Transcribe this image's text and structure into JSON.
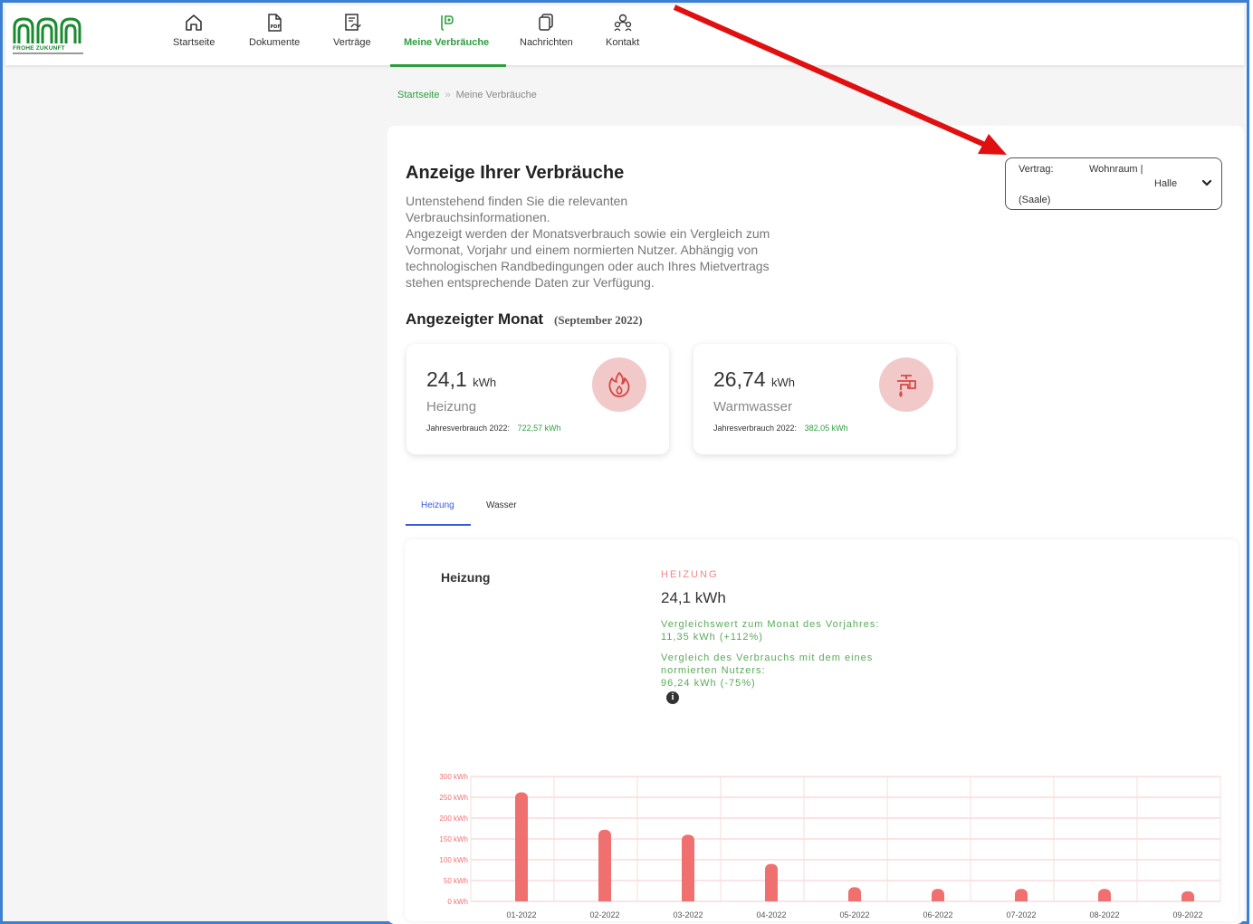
{
  "nav": {
    "logo_text": "FROHE ZUKUNFT",
    "items": [
      {
        "label": "Startseite",
        "icon": "home-icon"
      },
      {
        "label": "Dokumente",
        "icon": "pdf-document-icon"
      },
      {
        "label": "Verträge",
        "icon": "contract-icon"
      },
      {
        "label": "Meine Verbräuche",
        "icon": "consumption-icon",
        "active": true
      },
      {
        "label": "Nachrichten",
        "icon": "messages-icon"
      },
      {
        "label": "Kontakt",
        "icon": "contact-icon"
      }
    ]
  },
  "breadcrumb": {
    "home": "Startseite",
    "separator": "»",
    "current": "Meine Verbräuche"
  },
  "page": {
    "title": "Anzeige Ihrer Verbräuche",
    "description_1": "Untenstehend finden Sie die relevanten Verbrauchsinformationen.",
    "description_2": "Angezeigt werden der Monatsverbrauch sowie ein Vergleich zum Vormonat, Vorjahr und einem normierten Nutzer. Abhängig von technologischen Randbedingungen oder auch Ihres Mietvertrags stehen entsprechende Daten zur Verfügung."
  },
  "contract": {
    "label": "Vertrag:",
    "value_1": "Wohnraum |",
    "value_2": "Halle",
    "value_3": "(Saale)"
  },
  "month": {
    "title": "Angezeigter Monat",
    "value": "(September 2022)"
  },
  "cards": [
    {
      "value": "24,1",
      "unit": "kWh",
      "name": "Heizung",
      "yearly_label": "Jahresverbrauch 2022:",
      "yearly_value": "722,57 kWh",
      "icon": "flame-icon"
    },
    {
      "value": "26,74",
      "unit": "kWh",
      "name": "Warmwasser",
      "yearly_label": "Jahresverbrauch 2022:",
      "yearly_value": "382,05 kWh",
      "icon": "faucet-icon"
    }
  ],
  "tabs": [
    {
      "label": "Heizung",
      "active": true
    },
    {
      "label": "Wasser",
      "active": false
    }
  ],
  "section": {
    "title": "Heizung",
    "category": "HEIZUNG",
    "value": "24,1 kWh",
    "cmp1_label": "Vergleichswert zum Monat des Vorjahres:",
    "cmp1_value": "11,35 kWh (+112%)",
    "cmp2_label": "Vergleich des Verbrauchs mit dem eines normierten Nutzers:",
    "cmp2_value": "96,24 kWh (-75%)"
  },
  "colors": {
    "accent": "#2f9e3f",
    "bar": "#f07070",
    "tab_active": "#3a5bd9",
    "frame": "#3d7fd1",
    "arrow": "#e01010"
  },
  "chart_data": {
    "type": "bar",
    "categories": [
      "01-2022",
      "02-2022",
      "03-2022",
      "04-2022",
      "05-2022",
      "06-2022",
      "07-2022",
      "08-2022",
      "09-2022"
    ],
    "values": [
      262,
      172,
      160,
      90,
      34,
      30,
      30,
      30,
      24.1
    ],
    "y_ticks": [
      "0 kWh",
      "50 kWh",
      "100 kWh",
      "150 kWh",
      "200 kWh",
      "250 kWh",
      "300 kWh"
    ],
    "ylim": [
      0,
      300
    ],
    "grid": true
  }
}
